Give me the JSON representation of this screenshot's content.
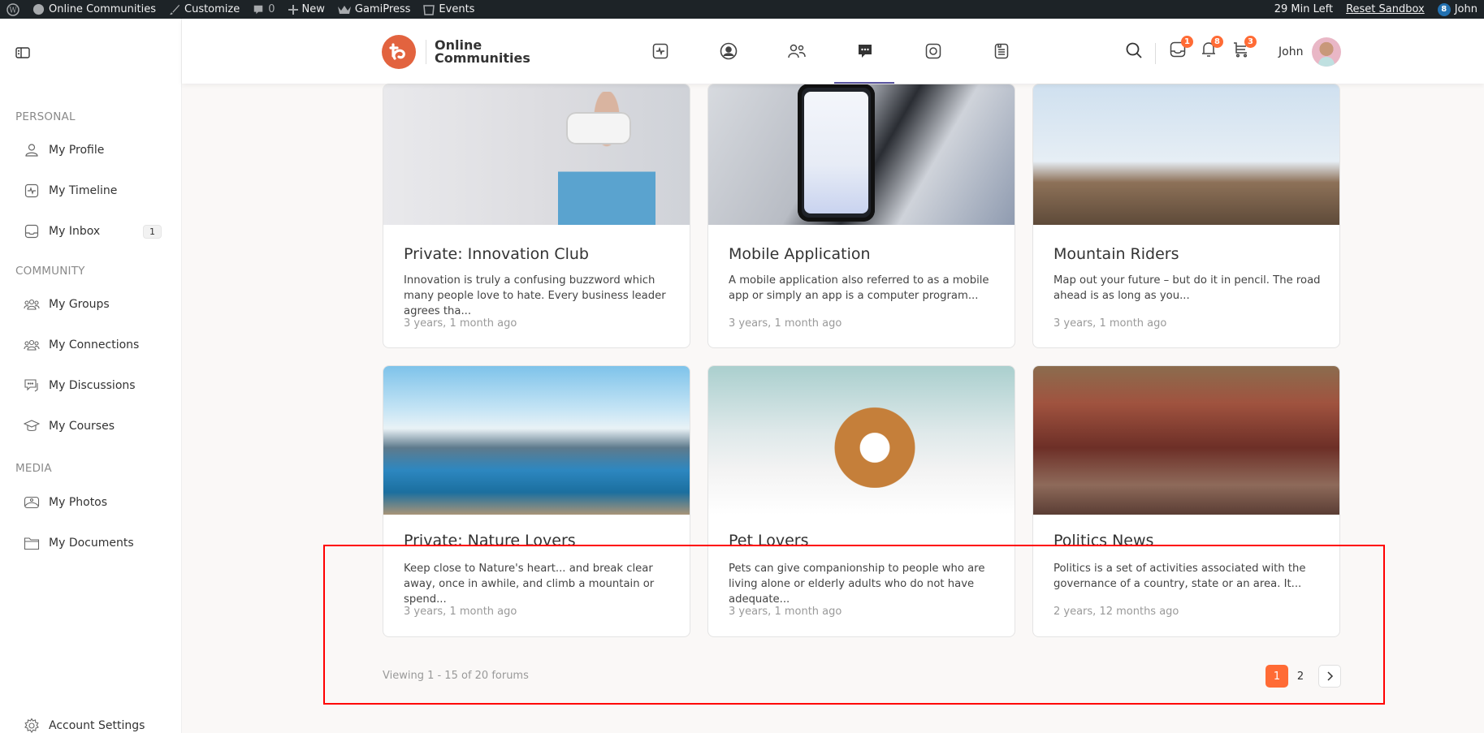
{
  "adminbar": {
    "site_name": "Online Communities",
    "customize": "Customize",
    "comments_count": "0",
    "new": "New",
    "gamipress": "GamiPress",
    "events": "Events",
    "time_left": "29 Min Left",
    "reset_sandbox": "Reset Sandbox",
    "notif_badge": "8",
    "user": "John"
  },
  "sidebar": {
    "sections": [
      {
        "label": "PERSONAL"
      },
      {
        "label": "COMMUNITY"
      },
      {
        "label": "MEDIA"
      }
    ],
    "items": [
      {
        "label": "My Profile",
        "icon": "user-icon"
      },
      {
        "label": "My Timeline",
        "icon": "activity-icon"
      },
      {
        "label": "My Inbox",
        "icon": "inbox-icon",
        "badge": "1"
      },
      {
        "label": "My Groups",
        "icon": "groups-icon"
      },
      {
        "label": "My Connections",
        "icon": "connections-icon"
      },
      {
        "label": "My Discussions",
        "icon": "discussions-icon"
      },
      {
        "label": "My Courses",
        "icon": "courses-icon"
      },
      {
        "label": "My Photos",
        "icon": "photos-icon"
      },
      {
        "label": "My Documents",
        "icon": "documents-icon"
      }
    ],
    "account_settings": "Account Settings"
  },
  "header": {
    "logo_line1": "Online",
    "logo_line2": "Communities",
    "nav": [
      "activity",
      "members",
      "groups",
      "forums",
      "photos",
      "documents"
    ],
    "active_nav": "forums",
    "inbox_count": "1",
    "notifications_count": "8",
    "cart_count": "3",
    "user_name": "John",
    "accent_color": "#ff6b35"
  },
  "forums": [
    {
      "title": "Private: Innovation Club",
      "description": "Innovation is truly a confusing buzzword which many people love to hate. Every business leader agrees tha...",
      "time": "3 years, 1 month ago"
    },
    {
      "title": "Mobile Application",
      "description": "A mobile application also referred to as a mobile app or simply an app is a computer program...",
      "time": "3 years, 1 month ago"
    },
    {
      "title": "Mountain Riders",
      "description": "Map out your future – but do it in pencil. The road ahead is as long as you...",
      "time": "3 years, 1 month ago"
    },
    {
      "title": "Private: Nature Lovers",
      "description": "Keep close to Nature's heart... and break clear away, once in awhile, and climb a mountain or spend...",
      "time": "3 years, 1 month ago"
    },
    {
      "title": "Pet Lovers",
      "description": "Pets can give companionship to people who are living alone or elderly adults who do not have adequate...",
      "time": "3 years, 1 month ago"
    },
    {
      "title": "Politics News",
      "description": "Politics is a set of activities associated with the governance of a country, state or an area. It...",
      "time": "2 years, 12 months ago"
    }
  ],
  "pagination": {
    "viewing": "Viewing 1 - 15 of 20 forums",
    "pages": [
      "1",
      "2"
    ],
    "current": "1"
  }
}
